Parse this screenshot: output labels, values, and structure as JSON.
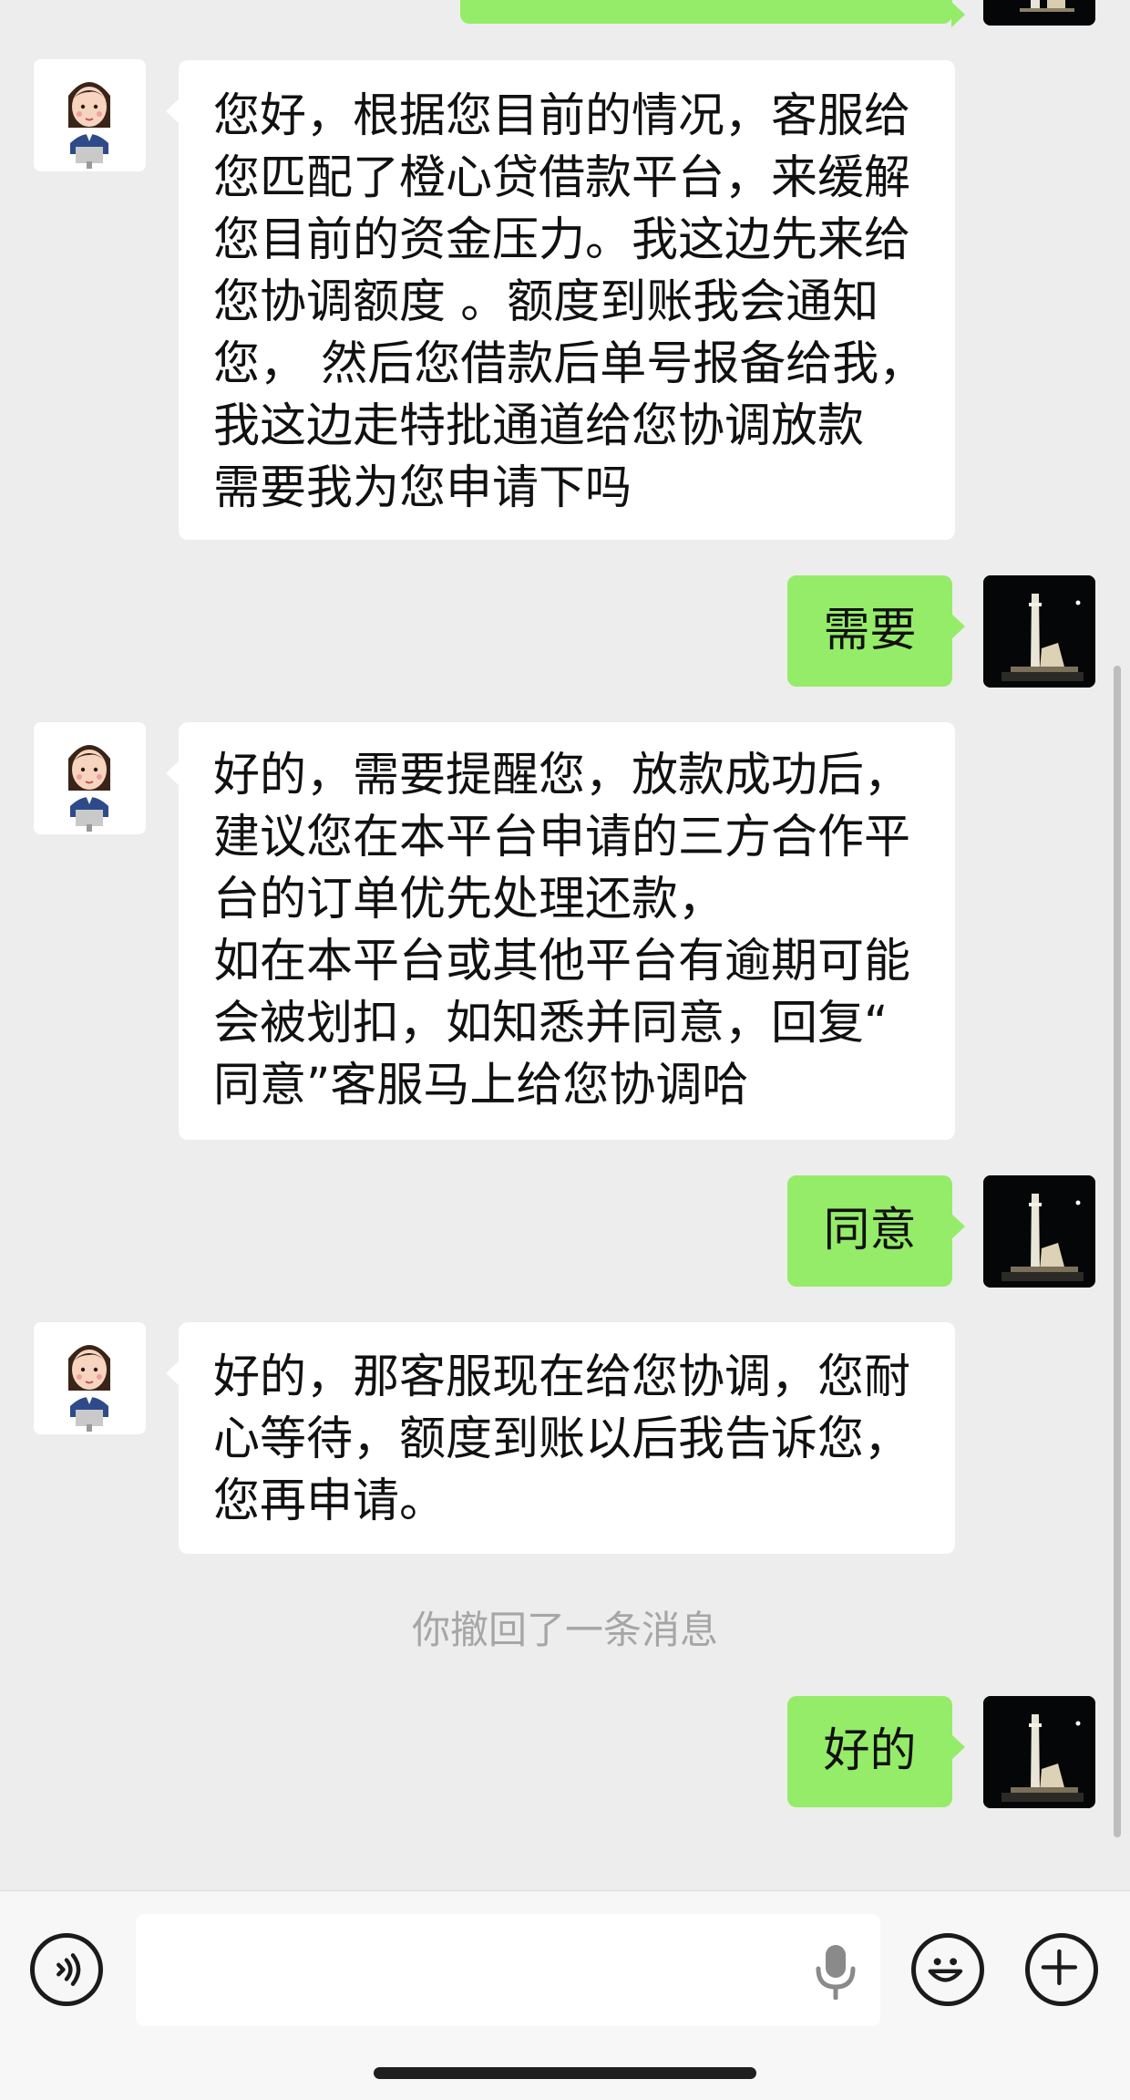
{
  "chat": {
    "agent_message_1": {
      "lines": [
        "您好，根据您目前的情况，客服给",
        "您匹配了橙心贷借款平台，来缓解",
        "您目前的资金压力。我这边先来给",
        "您协调额度 。额度到账我会通知",
        "您， 然后您借款后单号报备给我，",
        "我这边走特批通道给您协调放款",
        "需要我为您申请下吗"
      ]
    },
    "user_message_1": "需要",
    "agent_message_2": {
      "lines": [
        "好的，需要提醒您，放款成功后，",
        "建议您在本平台申请的三方合作平",
        "台的订单优先处理还款，",
        "如在本平台或其他平台有逾期可能",
        "会被划扣，如知悉并同意，回复“",
        "同意”客服马上给您协调哈"
      ]
    },
    "user_message_2": "同意",
    "agent_message_3": {
      "lines": [
        "好的，那客服现在给您协调，您耐",
        "心等待，额度到账以后我告诉您，",
        "您再申请。"
      ]
    },
    "system_notice": "你撤回了一条消息",
    "user_message_3": "好的"
  },
  "toolbar": {
    "voice_icon": "voice-icon",
    "mic_icon": "microphone-icon",
    "emoji_icon": "emoji-icon",
    "plus_icon": "plus-icon",
    "input_value": ""
  },
  "colors": {
    "background": "#ededed",
    "user_bubble": "#95ec69",
    "agent_bubble": "#ffffff",
    "system_text": "#a6a6a6"
  }
}
